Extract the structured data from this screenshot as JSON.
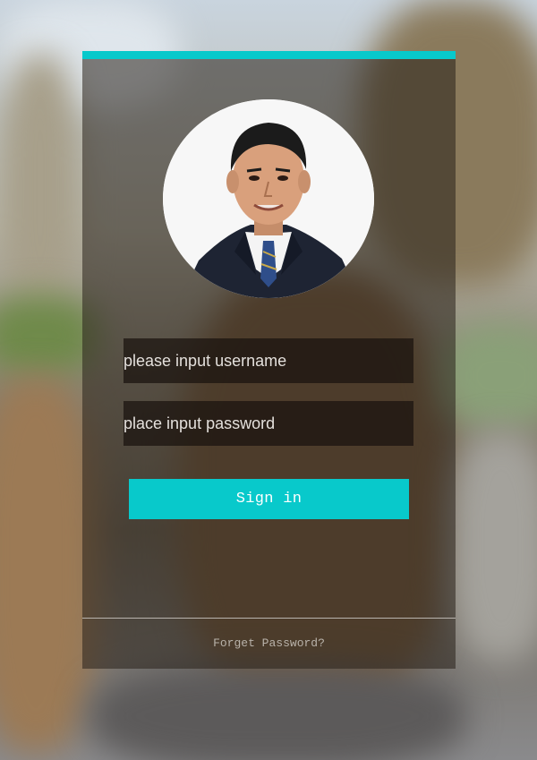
{
  "login": {
    "username_placeholder": "please input username",
    "password_placeholder": "place input password",
    "signin_label": "Sign in",
    "forget_label": "Forget Password?"
  },
  "colors": {
    "accent": "#08c9cb",
    "card_bg": "rgba(40,32,26,0.55)",
    "field_bg": "rgba(25,18,14,0.72)"
  },
  "icons": {
    "avatar": "user-avatar-photo"
  }
}
